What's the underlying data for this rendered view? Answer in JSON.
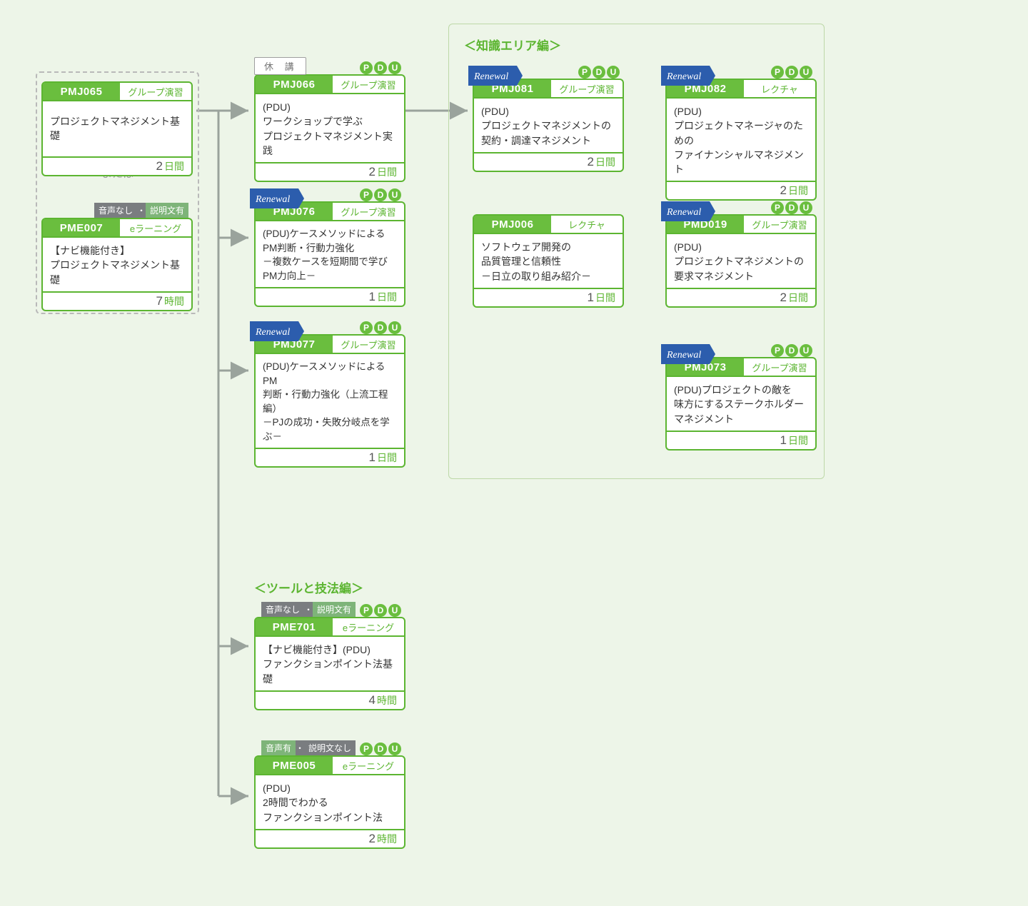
{
  "labels": {
    "or": "または",
    "group_knowledge": "＜知識エリア編＞",
    "group_tools": "＜ツールと技法編＞",
    "pdu_letters": [
      "P",
      "D",
      "U"
    ],
    "renewal": "Renewal",
    "suspended": "休 講"
  },
  "audio_badges": {
    "no_audio_has_text": {
      "left": "音声なし",
      "dot": "・",
      "right": "説明文有"
    },
    "has_audio_no_text": {
      "left": "音声有",
      "dot": "・",
      "right": "説明文なし"
    }
  },
  "cards": {
    "pmj065": {
      "code": "PMJ065",
      "type": "グループ演習",
      "body": "プロジェクトマネジメント基礎",
      "dur_num": "2",
      "dur_unit": "日間"
    },
    "pme007": {
      "code": "PME007",
      "type": "eラーニング",
      "body": "【ナビ機能付き】\nプロジェクトマネジメント基礎",
      "dur_num": "7",
      "dur_unit": "時間"
    },
    "pmj066": {
      "code": "PMJ066",
      "type": "グループ演習",
      "body": "(PDU)\nワークショップで学ぶ\nプロジェクトマネジメント実践",
      "dur_num": "2",
      "dur_unit": "日間"
    },
    "pmj076": {
      "code": "PMJ076",
      "type": "グループ演習",
      "body": "(PDU)ケースメソッドによる\nPM判断・行動力強化\n－複数ケースを短期間で学びPM力向上－",
      "dur_num": "1",
      "dur_unit": "日間"
    },
    "pmj077": {
      "code": "PMJ077",
      "type": "グループ演習",
      "body": "(PDU)ケースメソッドによるPM\n判断・行動力強化（上流工程編）\n－PJの成功・失敗分岐点を学ぶ－",
      "dur_num": "1",
      "dur_unit": "日間"
    },
    "pmj081": {
      "code": "PMJ081",
      "type": "グループ演習",
      "body": "(PDU)\nプロジェクトマネジメントの\n契約・調達マネジメント",
      "dur_num": "2",
      "dur_unit": "日間"
    },
    "pmj082": {
      "code": "PMJ082",
      "type": "レクチャ",
      "body": "(PDU)\nプロジェクトマネージャのための\nファイナンシャルマネジメント",
      "dur_num": "2",
      "dur_unit": "日間"
    },
    "pmj006": {
      "code": "PMJ006",
      "type": "レクチャ",
      "body": "ソフトウェア開発の\n品質管理と信頼性\n－日立の取り組み紹介－",
      "dur_num": "1",
      "dur_unit": "日間"
    },
    "pmd019": {
      "code": "PMD019",
      "type": "グループ演習",
      "body": "(PDU)\nプロジェクトマネジメントの\n要求マネジメント",
      "dur_num": "2",
      "dur_unit": "日間"
    },
    "pmj073": {
      "code": "PMJ073",
      "type": "グループ演習",
      "body": "(PDU)プロジェクトの敵を\n味方にするステークホルダー\nマネジメント",
      "dur_num": "1",
      "dur_unit": "日間"
    },
    "pme701": {
      "code": "PME701",
      "type": "eラーニング",
      "body": "【ナビ機能付き】(PDU)\nファンクションポイント法基礎",
      "dur_num": "4",
      "dur_unit": "時間"
    },
    "pme005": {
      "code": "PME005",
      "type": "eラーニング",
      "body": "(PDU)\n2時間でわかる\nファンクションポイント法",
      "dur_num": "2",
      "dur_unit": "時間"
    }
  }
}
